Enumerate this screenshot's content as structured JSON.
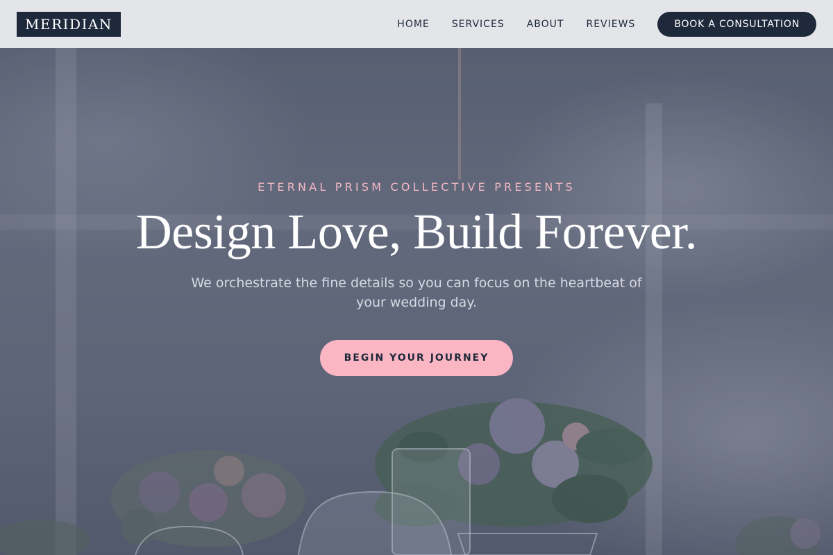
{
  "header": {
    "logo": "MERIDIAN",
    "nav": [
      "HOME",
      "SERVICES",
      "ABOUT",
      "REVIEWS"
    ],
    "cta": "BOOK A CONSULTATION"
  },
  "hero": {
    "eyebrow": "ETERNAL PRISM COLLECTIVE PRESENTS",
    "headline": "Design Love, Build Forever.",
    "subtext": "We orchestrate the fine details so you can focus on the heartbeat of your wedding day.",
    "button": "BEGIN YOUR JOURNEY",
    "background": "wedding-table-florals-photo"
  },
  "colors": {
    "navy": "#1e293b",
    "pink": "#fbb6c4",
    "eyebrow_pink": "#f4b8c5",
    "header_bg": "#e4e5e8"
  }
}
